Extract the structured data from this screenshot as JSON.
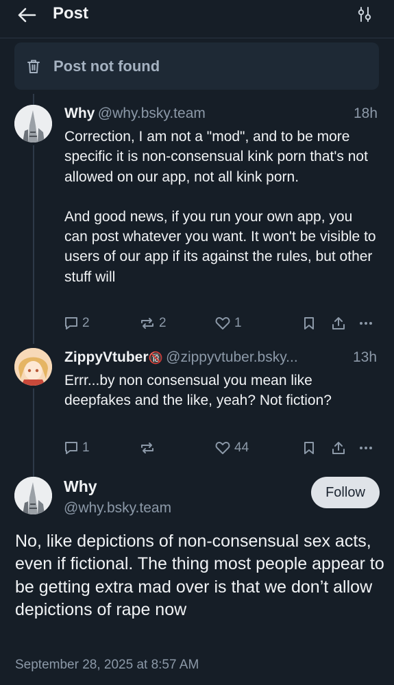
{
  "header": {
    "title": "Post",
    "back_icon": "arrow-left-icon",
    "sort_icon": "sliders-icon"
  },
  "notice": {
    "icon": "trash-icon",
    "text": "Post not found"
  },
  "replies": [
    {
      "name": "Why",
      "handle": "@why.bsky.team",
      "time": "18h",
      "text": [
        "Correction, I am not a \"mod\", and to be more specific it is non-consensual kink porn that's not allowed on our app, not all kink porn.",
        "And good news, if you run your own app, you can post whatever you want. It won't be visible to users of our app if its against the rules, but other stuff will"
      ],
      "replies": "2",
      "reposts": "2",
      "likes": "1"
    },
    {
      "name": "ZippyVtuber",
      "badge": "🔞",
      "handle": "@zippyvtuber.bsky...",
      "time": "13h",
      "text": [
        "Errr...by non consensual you mean like deepfakes and the like, yeah? Not fiction?"
      ],
      "replies": "1",
      "reposts": "",
      "likes": "44"
    }
  ],
  "main_post": {
    "name": "Why",
    "handle": "@why.bsky.team",
    "follow_label": "Follow",
    "text": "No, like depictions of non-consensual sex acts, even if fictional. The thing most people appear to be getting extra mad over is that we don’t allow depictions of rape now",
    "date": "September 28, 2025 at 8:57 AM"
  },
  "colors": {
    "background": "#161e27",
    "card": "#1e2935",
    "muted": "#8c99a8",
    "text": "#f1f3f5",
    "follow_bg": "#dfe3e8"
  }
}
